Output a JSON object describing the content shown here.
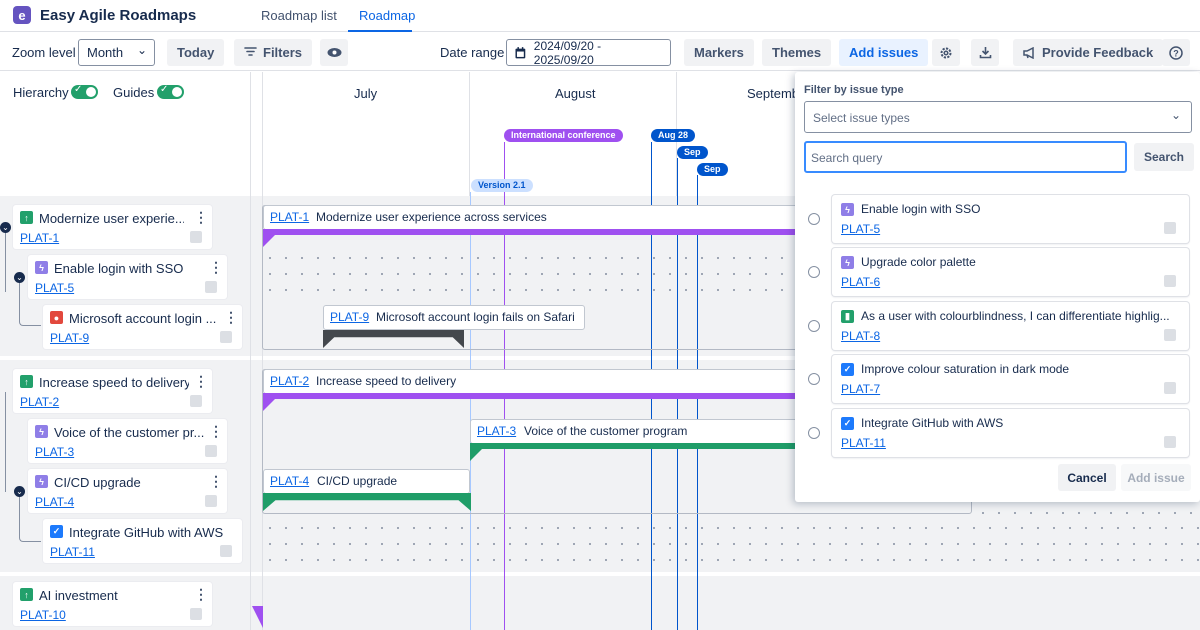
{
  "app": {
    "title": "Easy Agile Roadmaps",
    "logo_letter": "e"
  },
  "nav": {
    "tabs": [
      {
        "label": "Roadmap list"
      },
      {
        "label": "Roadmap"
      }
    ],
    "active": "Roadmap"
  },
  "toolbar": {
    "zoom_label": "Zoom level",
    "zoom_value": "Month",
    "today": "Today",
    "filters": "Filters",
    "date_range_label": "Date range",
    "date_range_value": "2024/09/20 - 2025/09/20",
    "markers": "Markers",
    "themes": "Themes",
    "add_issues": "Add issues",
    "provide_feedback": "Provide Feedback"
  },
  "toggles": {
    "hierarchy": "Hierarchy",
    "guides": "Guides",
    "hierarchy_on": true,
    "guides_on": true
  },
  "months": [
    "July",
    "August",
    "Septemb"
  ],
  "markers": [
    {
      "label": "International conference",
      "color": "#9f50f0"
    },
    {
      "label": "Aug 28",
      "color": "#0055cc"
    },
    {
      "label": "Sep",
      "color": "#0055cc"
    },
    {
      "label": "Sep",
      "color": "#0055cc"
    },
    {
      "label": "Version 2.1",
      "color": "#cce0ff"
    }
  ],
  "issues": [
    {
      "key": "PLAT-1",
      "title": "Modernize user experie...",
      "bar_title": "Modernize user experience across services",
      "type": "story"
    },
    {
      "key": "PLAT-5",
      "title": "Enable login with SSO",
      "type": "feature"
    },
    {
      "key": "PLAT-9",
      "title": "Microsoft account login ...",
      "bar_title": "Microsoft account login fails on Safari",
      "type": "bug"
    },
    {
      "key": "PLAT-2",
      "title": "Increase speed to delivery",
      "bar_title": "Increase speed to delivery",
      "type": "story"
    },
    {
      "key": "PLAT-3",
      "title": "Voice of the customer pr...",
      "bar_title": "Voice of the customer program",
      "type": "feature"
    },
    {
      "key": "PLAT-4",
      "title": "CI/CD upgrade",
      "bar_title": "CI/CD upgrade",
      "type": "feature"
    },
    {
      "key": "PLAT-11",
      "title": "Integrate GitHub with AWS",
      "type": "task"
    },
    {
      "key": "PLAT-10",
      "title": "AI investment",
      "type": "story"
    }
  ],
  "popup": {
    "filter_label": "Filter by issue type",
    "select_placeholder": "Select issue types",
    "search_placeholder": "Search query",
    "search_button": "Search",
    "results": [
      {
        "key": "PLAT-5",
        "title": "Enable login with SSO",
        "type": "feature"
      },
      {
        "key": "PLAT-6",
        "title": "Upgrade color palette",
        "type": "feature"
      },
      {
        "key": "PLAT-8",
        "title": "As a user with colourblindness, I can differentiate highlig...",
        "type": "story"
      },
      {
        "key": "PLAT-7",
        "title": "Improve colour saturation in dark mode",
        "type": "task"
      },
      {
        "key": "PLAT-11",
        "title": "Integrate GitHub with AWS",
        "type": "task"
      }
    ],
    "cancel": "Cancel",
    "add_issue": "Add issue"
  },
  "colors": {
    "accent": "#0c66e4",
    "purple": "#9f50f0",
    "green": "#1f9d68",
    "dark": "#44484d",
    "marker_blue": "#0055cc"
  }
}
